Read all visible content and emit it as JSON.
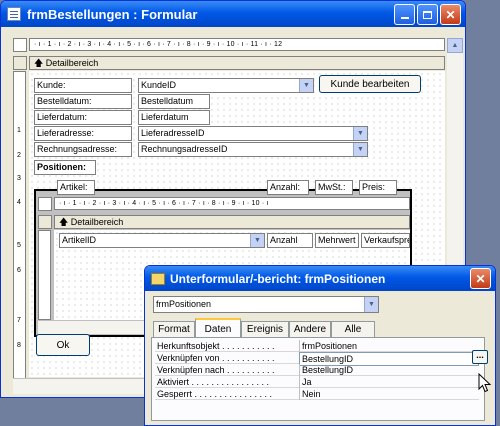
{
  "main": {
    "title": "frmBestellungen : Formular",
    "ruler_text": "· ı · 1 · ı · 2 · ı · 3 · ı · 4 · ı · 5 · ı · 6 · ı · 7 · ı · 8 · ı · 9 · ı · 10 · ı · 11 · ı · 12",
    "vruler_numbers": [
      "1",
      "2",
      "3",
      "4",
      "5",
      "6",
      "7",
      "8"
    ],
    "section_label": "Detailbereich",
    "fields": [
      {
        "label": "Kunde:",
        "value": "KundeID"
      },
      {
        "label": "Bestelldatum:",
        "value": "Bestelldatum"
      },
      {
        "label": "Lieferdatum:",
        "value": "Lieferdatum"
      },
      {
        "label": "Lieferadresse:",
        "value": "LieferadresseID"
      },
      {
        "label": "Rechnungsadresse:",
        "value": "RechnungsadresseID"
      }
    ],
    "kunde_button": "Kunde bearbeiten",
    "positionen_label": "Positionen:",
    "sub_headers": {
      "artikel": "Artikel:",
      "anzahl": "Anzahl:",
      "mwst": "MwSt.:",
      "preis": "Preis:"
    },
    "sub_ruler_text": "· ı · 1 · ı · 2 · ı · 3 · ı · 4 · ı · 5 · ı · 6 · ı · 7 · ı · 8 · ı · 9 · ı · 10 · ı",
    "sub_section_label": "Detailbereich",
    "sub_fields": {
      "artikel": "ArtikelID",
      "anzahl": "Anzahl",
      "mwst": "Mehrwert",
      "preis": "Verkaufspre"
    },
    "ok_button": "Ok"
  },
  "dialog": {
    "title": "Unterformular/-bericht: frmPositionen",
    "object_select": "frmPositionen",
    "tabs": [
      "Format",
      "Daten",
      "Ereignis",
      "Andere",
      "Alle"
    ],
    "active_tab": "Daten",
    "properties": [
      {
        "name": "Herkunftsobjekt . . . . . . . . . . .",
        "value": "frmPositionen"
      },
      {
        "name": "Verknüpfen von . . . . . . . . . . .",
        "value": "BestellungID"
      },
      {
        "name": "Verknüpfen nach . . . . . . . . . .",
        "value": "BestellungID"
      },
      {
        "name": "Aktiviert . . . . . . . . . . . . . . . .",
        "value": "Ja"
      },
      {
        "name": "Gesperrt . . . . . . . . . . . . . . . .",
        "value": "Nein"
      }
    ],
    "builder_button": "..."
  },
  "icons": {
    "window": "form-icon",
    "dialog": "properties-icon",
    "minimize": "minimize-icon",
    "maximize": "maximize-icon",
    "close": "close-icon",
    "dropdown": "chevron-down-icon",
    "cursor": "mouse-pointer-icon"
  }
}
